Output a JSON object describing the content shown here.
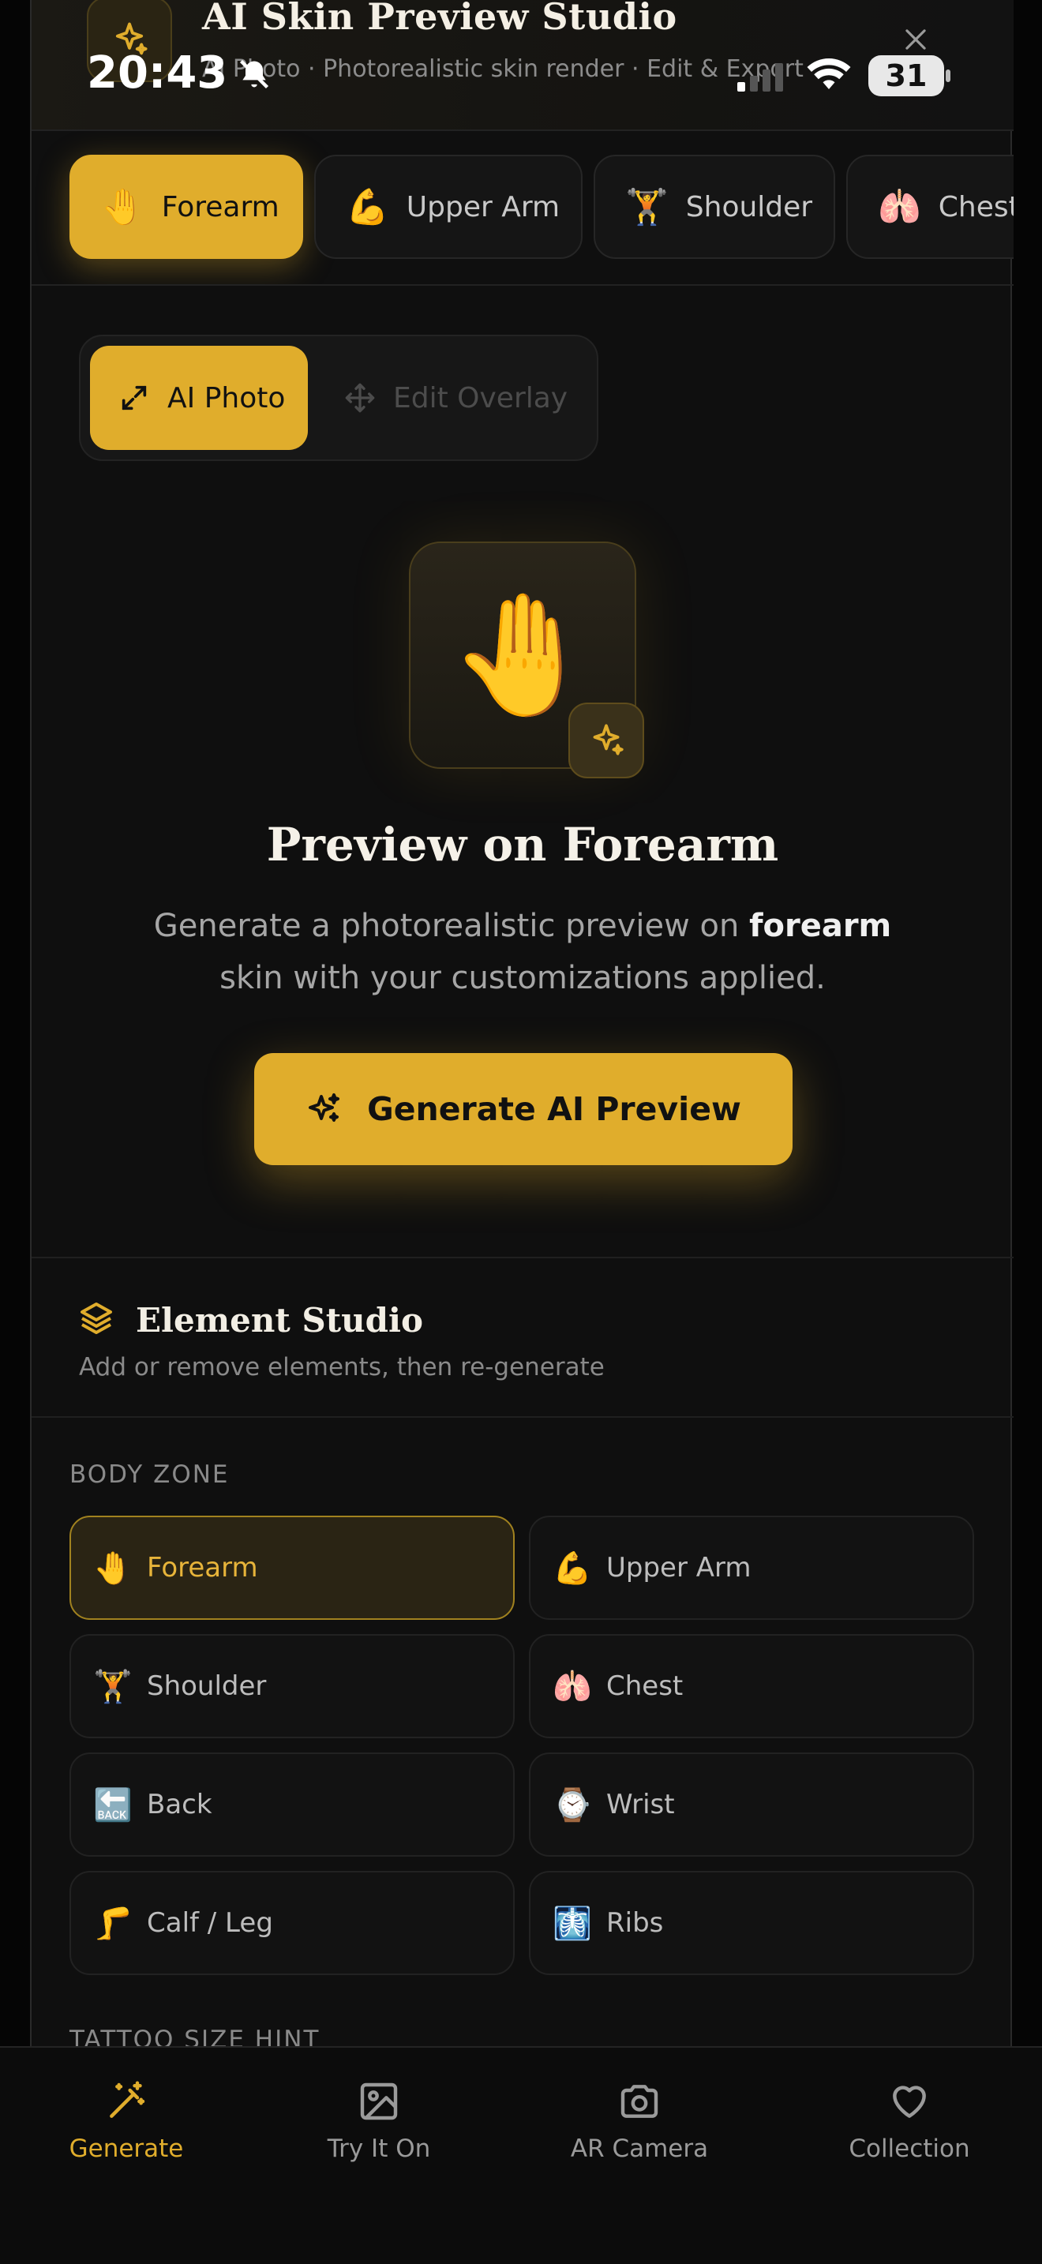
{
  "status_bar": {
    "time": "20:43",
    "battery": "31"
  },
  "header": {
    "title": "AI Skin Preview Studio",
    "subtitle": "AI Photo · Photorealistic skin render · Edit & Export"
  },
  "zone_tabs": [
    {
      "emoji": "🤚",
      "label": "Forearm",
      "active": true
    },
    {
      "emoji": "💪",
      "label": "Upper Arm"
    },
    {
      "emoji": "🏋️",
      "label": "Shoulder"
    },
    {
      "emoji": "🫁",
      "label": "Chest"
    }
  ],
  "mode_toggle": {
    "ai_photo": "AI Photo",
    "edit_overlay": "Edit Overlay"
  },
  "hero": {
    "emoji": "🤚",
    "title": "Preview on Forearm",
    "desc_before": "Generate a photorealistic preview on ",
    "desc_bold": "forearm",
    "desc_after": " skin with your customizations applied.",
    "button": "Generate AI Preview"
  },
  "element_studio": {
    "title": "Element Studio",
    "subtitle": "Add or remove elements, then re-generate"
  },
  "body_zone": {
    "label": "BODY ZONE",
    "items": [
      {
        "emoji": "🤚",
        "label": "Forearm",
        "active": true
      },
      {
        "emoji": "💪",
        "label": "Upper Arm"
      },
      {
        "emoji": "🏋️",
        "label": "Shoulder"
      },
      {
        "emoji": "🫁",
        "label": "Chest"
      },
      {
        "emoji": "🔙",
        "label": "Back"
      },
      {
        "emoji": "⌚",
        "label": "Wrist"
      },
      {
        "emoji": "🦵",
        "label": "Calf / Leg"
      },
      {
        "emoji": "🩻",
        "label": "Ribs"
      }
    ]
  },
  "size_hint_label": "TATTOO SIZE HINT",
  "bottom_nav": [
    {
      "icon": "magic-wand-icon",
      "label": "Generate",
      "active": true
    },
    {
      "icon": "image-icon",
      "label": "Try It On"
    },
    {
      "icon": "camera-icon",
      "label": "AR Camera"
    },
    {
      "icon": "heart-icon",
      "label": "Collection"
    }
  ],
  "colors": {
    "accent": "#e0ad2c",
    "background": "#0f0f0f"
  }
}
